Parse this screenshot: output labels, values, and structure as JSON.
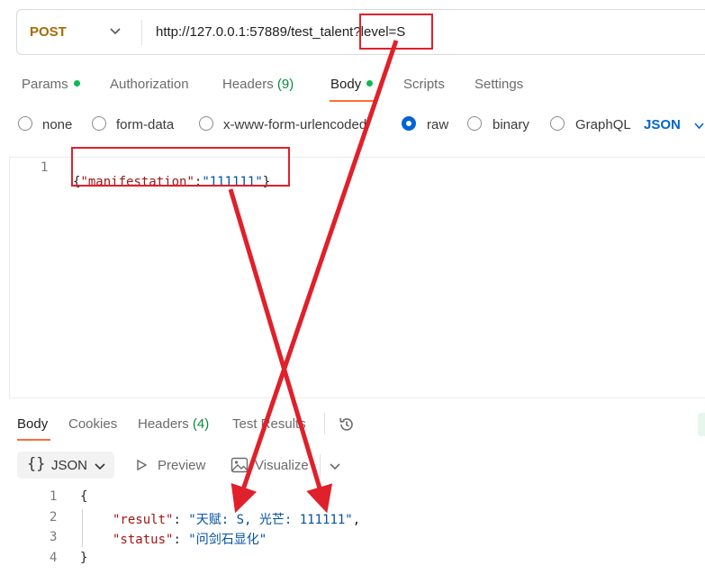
{
  "request": {
    "method": "POST",
    "url": "http://127.0.0.1:57889/test_talent?level=S"
  },
  "tabs": {
    "params": "Params",
    "authorization": "Authorization",
    "headers_label": "Headers",
    "headers_count": "(9)",
    "body": "Body",
    "scripts": "Scripts",
    "settings": "Settings"
  },
  "body_modes": {
    "none": "none",
    "form_data": "form-data",
    "urlencoded": "x-www-form-urlencoded",
    "raw": "raw",
    "binary": "binary",
    "graphql": "GraphQL",
    "format": "JSON",
    "selected": "raw"
  },
  "request_body": {
    "line_number": "1",
    "open_brace": "{",
    "key": "\"manifestation\"",
    "colon": ":",
    "value": "\"111111\"",
    "close_brace": "}"
  },
  "response_tabs": {
    "body": "Body",
    "cookies": "Cookies",
    "headers_label": "Headers",
    "headers_count": "(4)",
    "test_results": "Test Results"
  },
  "response_toolbar": {
    "format": "JSON",
    "preview": "Preview",
    "visualize": "Visualize"
  },
  "response_body": {
    "lines": [
      {
        "num": "1",
        "text": "{"
      },
      {
        "num": "2",
        "key": "\"result\"",
        "value": "\"天赋: S, 光芒: 111111\"",
        "trail": ","
      },
      {
        "num": "3",
        "key": "\"status\"",
        "value": "\"问剑石显化\"",
        "trail": ""
      },
      {
        "num": "4",
        "text": "}"
      }
    ]
  },
  "colors": {
    "accent": "#ff6c37",
    "method": "#a86a00",
    "link_blue": "#0265d2",
    "annotation_red": "#e0202a",
    "status_green": "#0cbb52"
  }
}
